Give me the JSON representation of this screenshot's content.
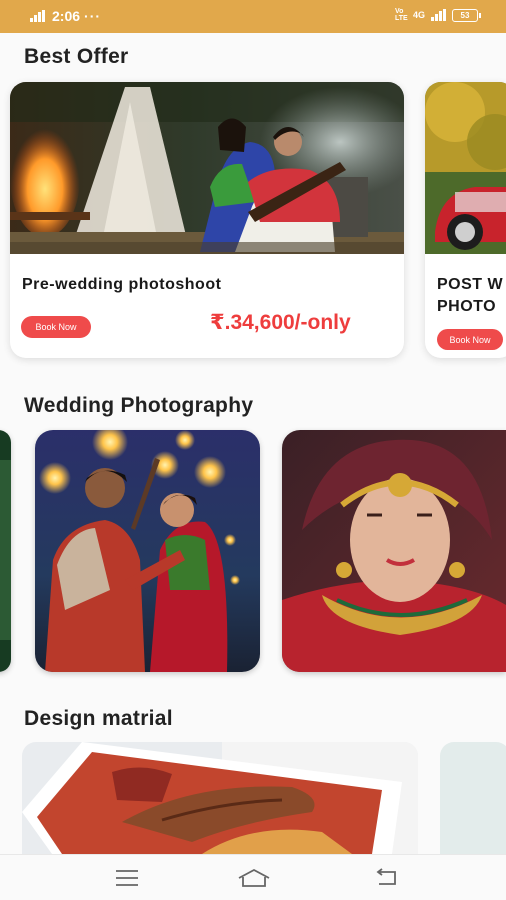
{
  "status_bar": {
    "time": "2:06",
    "dots": "···",
    "volte": "Vo LTE",
    "network": "4G",
    "battery": "53"
  },
  "sections": {
    "best_offer": "Best Offer",
    "wedding": "Wedding Photography",
    "design": "Design matrial"
  },
  "offers": [
    {
      "title": "Pre-wedding photoshoot",
      "button": "Book Now",
      "price": "₹.34,600/-only"
    },
    {
      "title_line1": "POST W",
      "title_line2": "PHOTO",
      "button": "Book Now"
    }
  ],
  "icons": {
    "menu": "menu-icon",
    "home": "home-icon",
    "back": "back-icon"
  },
  "colors": {
    "status_bar": "#e1a84b",
    "button": "#ef4b4b",
    "price": "#ee3d3d"
  }
}
